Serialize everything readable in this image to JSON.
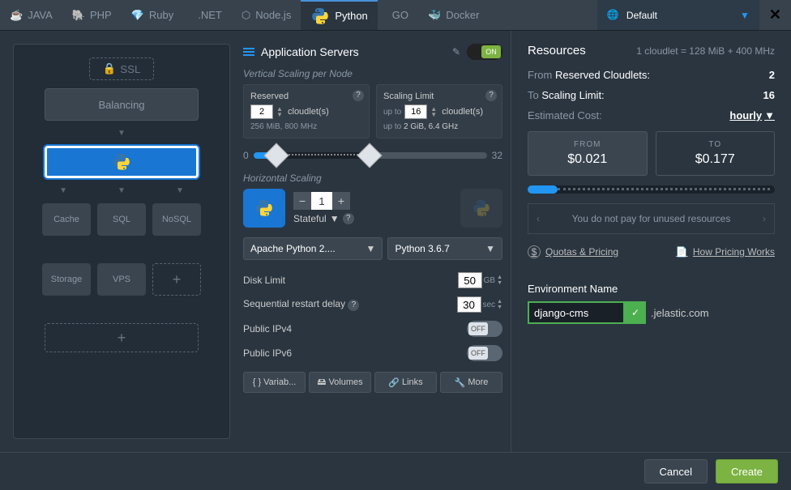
{
  "tabs": {
    "java": "JAVA",
    "php": "PHP",
    "ruby": "Ruby",
    "dotnet": ".NET",
    "node": "Node.js",
    "python": "Python",
    "go": "GO",
    "docker": "Docker"
  },
  "region": {
    "label": "Default"
  },
  "topology": {
    "ssl": "SSL",
    "balancing": "Balancing",
    "cache": "Cache",
    "sql": "SQL",
    "nosql": "NoSQL",
    "storage": "Storage",
    "vps": "VPS"
  },
  "appserver": {
    "title": "Application Servers",
    "toggle_on": "ON",
    "vertical_label": "Vertical Scaling per Node",
    "reserved": {
      "title": "Reserved",
      "value": "2",
      "unit": "cloudlet(s)",
      "detail": "256 MiB, 800 MHz"
    },
    "limit": {
      "title": "Scaling Limit",
      "prefix": "up to",
      "value": "16",
      "unit": "cloudlet(s)",
      "detail_prefix": "up to",
      "detail": "2 GiB, 6.4 GHz"
    },
    "slider_min": "0",
    "slider_max": "32",
    "horizontal_label": "Horizontal Scaling",
    "count": "1",
    "stateful": "Stateful",
    "stack": "Apache Python 2....",
    "version": "Python 3.6.7",
    "disk": {
      "label": "Disk Limit",
      "value": "50",
      "unit": "GB"
    },
    "restart": {
      "label": "Sequential restart delay",
      "value": "30",
      "unit": "sec"
    },
    "ipv4": {
      "label": "Public IPv4",
      "toggle": "OFF"
    },
    "ipv6": {
      "label": "Public IPv6",
      "toggle": "OFF"
    },
    "btabs": {
      "variables": "Variab...",
      "volumes": "Volumes",
      "links": "Links",
      "more": "More"
    }
  },
  "resources": {
    "title": "Resources",
    "note": "1 cloudlet = 128 MiB + 400 MHz",
    "from_label": "From",
    "from_text": "Reserved Cloudlets:",
    "from_value": "2",
    "to_label": "To",
    "to_text": "Scaling Limit:",
    "to_value": "16",
    "cost_label": "Estimated Cost:",
    "cost_mode": "hourly",
    "from_price_label": "FROM",
    "from_price": "$0.021",
    "to_price_label": "TO",
    "to_price": "$0.177",
    "info": "You do not pay for unused resources",
    "quotas": "Quotas & Pricing",
    "howpricing": "How Pricing Works"
  },
  "env": {
    "title": "Environment Name",
    "value": "django-cms",
    "domain": ".jelastic.com"
  },
  "footer": {
    "cancel": "Cancel",
    "create": "Create"
  }
}
